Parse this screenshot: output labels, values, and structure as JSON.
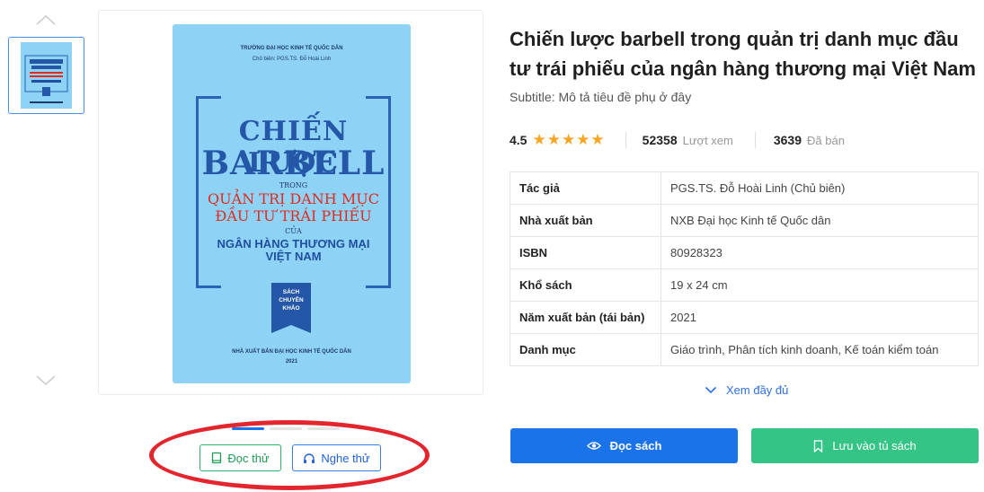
{
  "cover": {
    "top_line1": "TRƯỜNG ĐẠI HỌC KINH TẾ QUỐC DÂN",
    "top_line2": "Chủ biên: PGS.TS. Đỗ Hoài Linh",
    "title1": "CHIẾN LƯỢC",
    "title2": "BARBELL",
    "trong": "TRONG",
    "red1": "QUẢN TRỊ DANH MỤC",
    "red2": "ĐẦU TƯ TRÁI PHIẾU",
    "cua": "CỦA",
    "blue1": "NGÂN HÀNG THƯƠNG MẠI",
    "blue2": "VIỆT NAM",
    "ribbon1": "SÁCH",
    "ribbon2": "CHUYÊN",
    "ribbon3": "KHẢO",
    "publisher": "NHÀ XUẤT BẢN ĐẠI HỌC KINH TẾ QUỐC DÂN",
    "year": "2021"
  },
  "actions": {
    "read_sample": "Đọc thử",
    "listen_sample": "Nghe thử"
  },
  "book": {
    "title": "Chiến lược barbell trong quản trị danh mục đầu tư trái phiếu của ngân hàng thương mại Việt Nam",
    "subtitle": "Subtitle: Mô tả tiêu đề phụ ở đây",
    "rating": "4.5",
    "rating_value": 4.5,
    "stars": "★★★★★",
    "views": "52358",
    "views_label": "Lượt xem",
    "sold": "3639",
    "sold_label": "Đã bán"
  },
  "details": [
    {
      "key": "Tác giả",
      "value": "PGS.TS. Đỗ Hoài Linh (Chủ biên)"
    },
    {
      "key": "Nhà xuất bản",
      "value": "NXB Đại học Kinh tế Quốc dân"
    },
    {
      "key": "ISBN",
      "value": "80928323"
    },
    {
      "key": "Khổ sách",
      "value": "19 x 24 cm"
    },
    {
      "key": "Năm xuất bản (tái bản)",
      "value": "2021"
    },
    {
      "key": "Danh mục",
      "value": "Giáo trình, Phân tích kinh doanh, Kế toán kiểm toán"
    }
  ],
  "more_label": "Xem đầy đủ",
  "buttons": {
    "read_book": "Đọc sách",
    "save_to_shelf": "Lưu vào tủ sách"
  },
  "colors": {
    "primary": "#1a73e8",
    "success": "#34c486",
    "star": "#f5a623",
    "highlight": "#e3262e",
    "cover_bg": "#8ed3f5"
  }
}
